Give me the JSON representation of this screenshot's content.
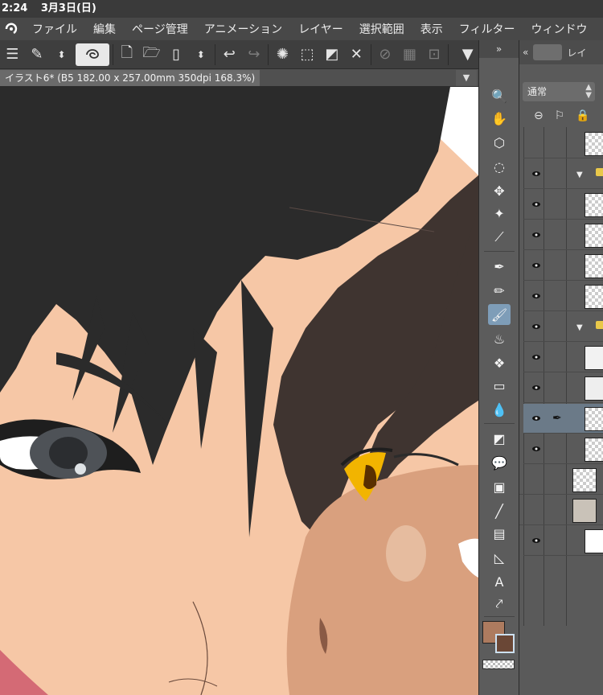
{
  "status_bar": {
    "time": "2:24",
    "date": "3月3日(日)"
  },
  "menu": {
    "items": [
      "ファイル",
      "編集",
      "ページ管理",
      "アニメーション",
      "レイヤー",
      "選択範囲",
      "表示",
      "フィルター",
      "ウィンドウ"
    ]
  },
  "document_tab": {
    "title": "イラスト6* (B5 182.00 x 257.00mm 350dpi 168.3%)"
  },
  "toolbar_icons": [
    "menu-icon",
    "brush-tool-icon",
    "stepper-icon",
    "snap-icon",
    "new-icon",
    "open-icon",
    "save-icon",
    "stepper-icon",
    "undo-icon",
    "redo-icon",
    "transform-icon",
    "select-icon",
    "fill-icon",
    "cross-icon",
    "clear-icon",
    "grid-icon",
    "crop-icon",
    "dropdown-icon"
  ],
  "layer_panel": {
    "tab_label": "レイ",
    "blend_mode": "通常",
    "layers": [
      {
        "visible": false,
        "type": "raster"
      },
      {
        "visible": true,
        "type": "folder",
        "expanded": true
      },
      {
        "visible": true,
        "type": "raster"
      },
      {
        "visible": true,
        "type": "raster"
      },
      {
        "visible": true,
        "type": "raster"
      },
      {
        "visible": true,
        "type": "raster"
      },
      {
        "visible": true,
        "type": "folder",
        "expanded": true
      },
      {
        "visible": true,
        "type": "raster"
      },
      {
        "visible": true,
        "type": "raster"
      },
      {
        "visible": true,
        "type": "raster",
        "selected": true
      },
      {
        "visible": true,
        "type": "raster"
      },
      {
        "visible": false,
        "type": "raster"
      },
      {
        "visible": false,
        "type": "raster"
      },
      {
        "visible": true,
        "type": "paper"
      }
    ]
  },
  "colors": {
    "main": "#ad7b5f",
    "sub": "#6a4736",
    "accent_selected": "#7e9db8"
  },
  "tools": [
    "zoom-icon",
    "hand-icon",
    "3d-icon",
    "lasso-icon",
    "move-icon",
    "wand-icon",
    "eyedropper-icon",
    "pen-icon",
    "pencil-icon",
    "brush-icon",
    "airbrush-icon",
    "decoration-icon",
    "eraser-icon",
    "blend-icon",
    "fill-icon",
    "balloon-icon",
    "gradient-icon",
    "line-icon",
    "frame-icon",
    "ruler-icon",
    "text-icon",
    "link-icon"
  ]
}
